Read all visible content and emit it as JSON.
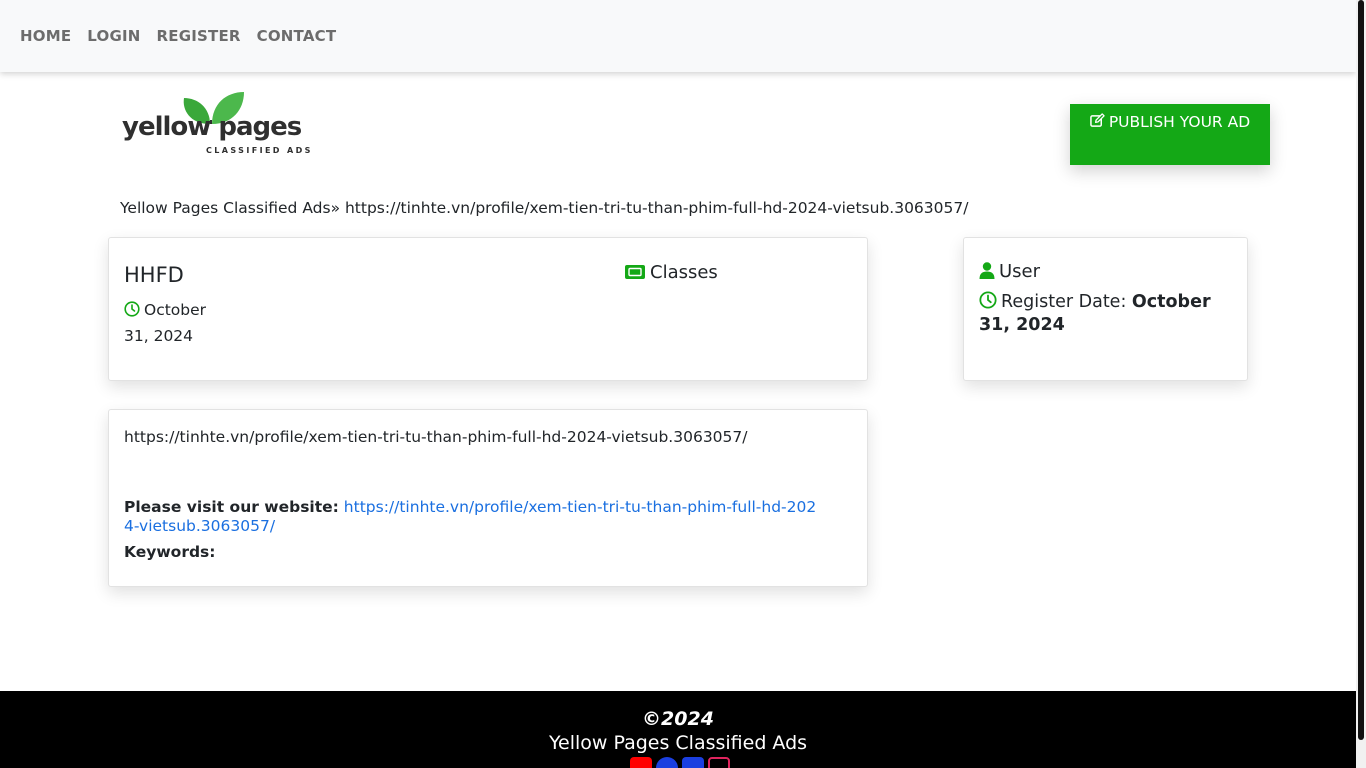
{
  "nav": {
    "items": [
      "HOME",
      "LOGIN",
      "REGISTER",
      "CONTACT"
    ]
  },
  "logo": {
    "word": "yellow pages",
    "sub": "CLASSIFIED ADS"
  },
  "publish_button": "PUBLISH YOUR AD",
  "breadcrumb": "Yellow Pages Classified Ads» https://tinhte.vn/profile/xem-tien-tri-tu-than-phim-full-hd-2024-vietsub.3063057/",
  "ad": {
    "title": "HHFD",
    "date": "October 31, 2024",
    "category": "Classes"
  },
  "user": {
    "name": "User",
    "register_label": "Register Date:",
    "register_date": "October 31, 2024"
  },
  "description": {
    "url_text": "https://tinhte.vn/profile/xem-tien-tri-tu-than-phim-full-hd-2024-vietsub.3063057/",
    "visit_label": "Please visit our website:",
    "visit_link": "https://tinhte.vn/profile/xem-tien-tri-tu-than-phim-full-hd-2024-vietsub.3063057/",
    "keywords_label": "Keywords:"
  },
  "footer": {
    "copyright": "©2024",
    "site_name": "Yellow Pages Classified Ads",
    "social_icons": [
      "youtube-icon",
      "facebook-icon",
      "twitter-icon",
      "instagram-icon"
    ]
  },
  "colors": {
    "accent_green": "#14a816",
    "link_blue": "#1a6fe0",
    "footer_bg": "#000000",
    "nav_bg": "#f8f9fa"
  }
}
